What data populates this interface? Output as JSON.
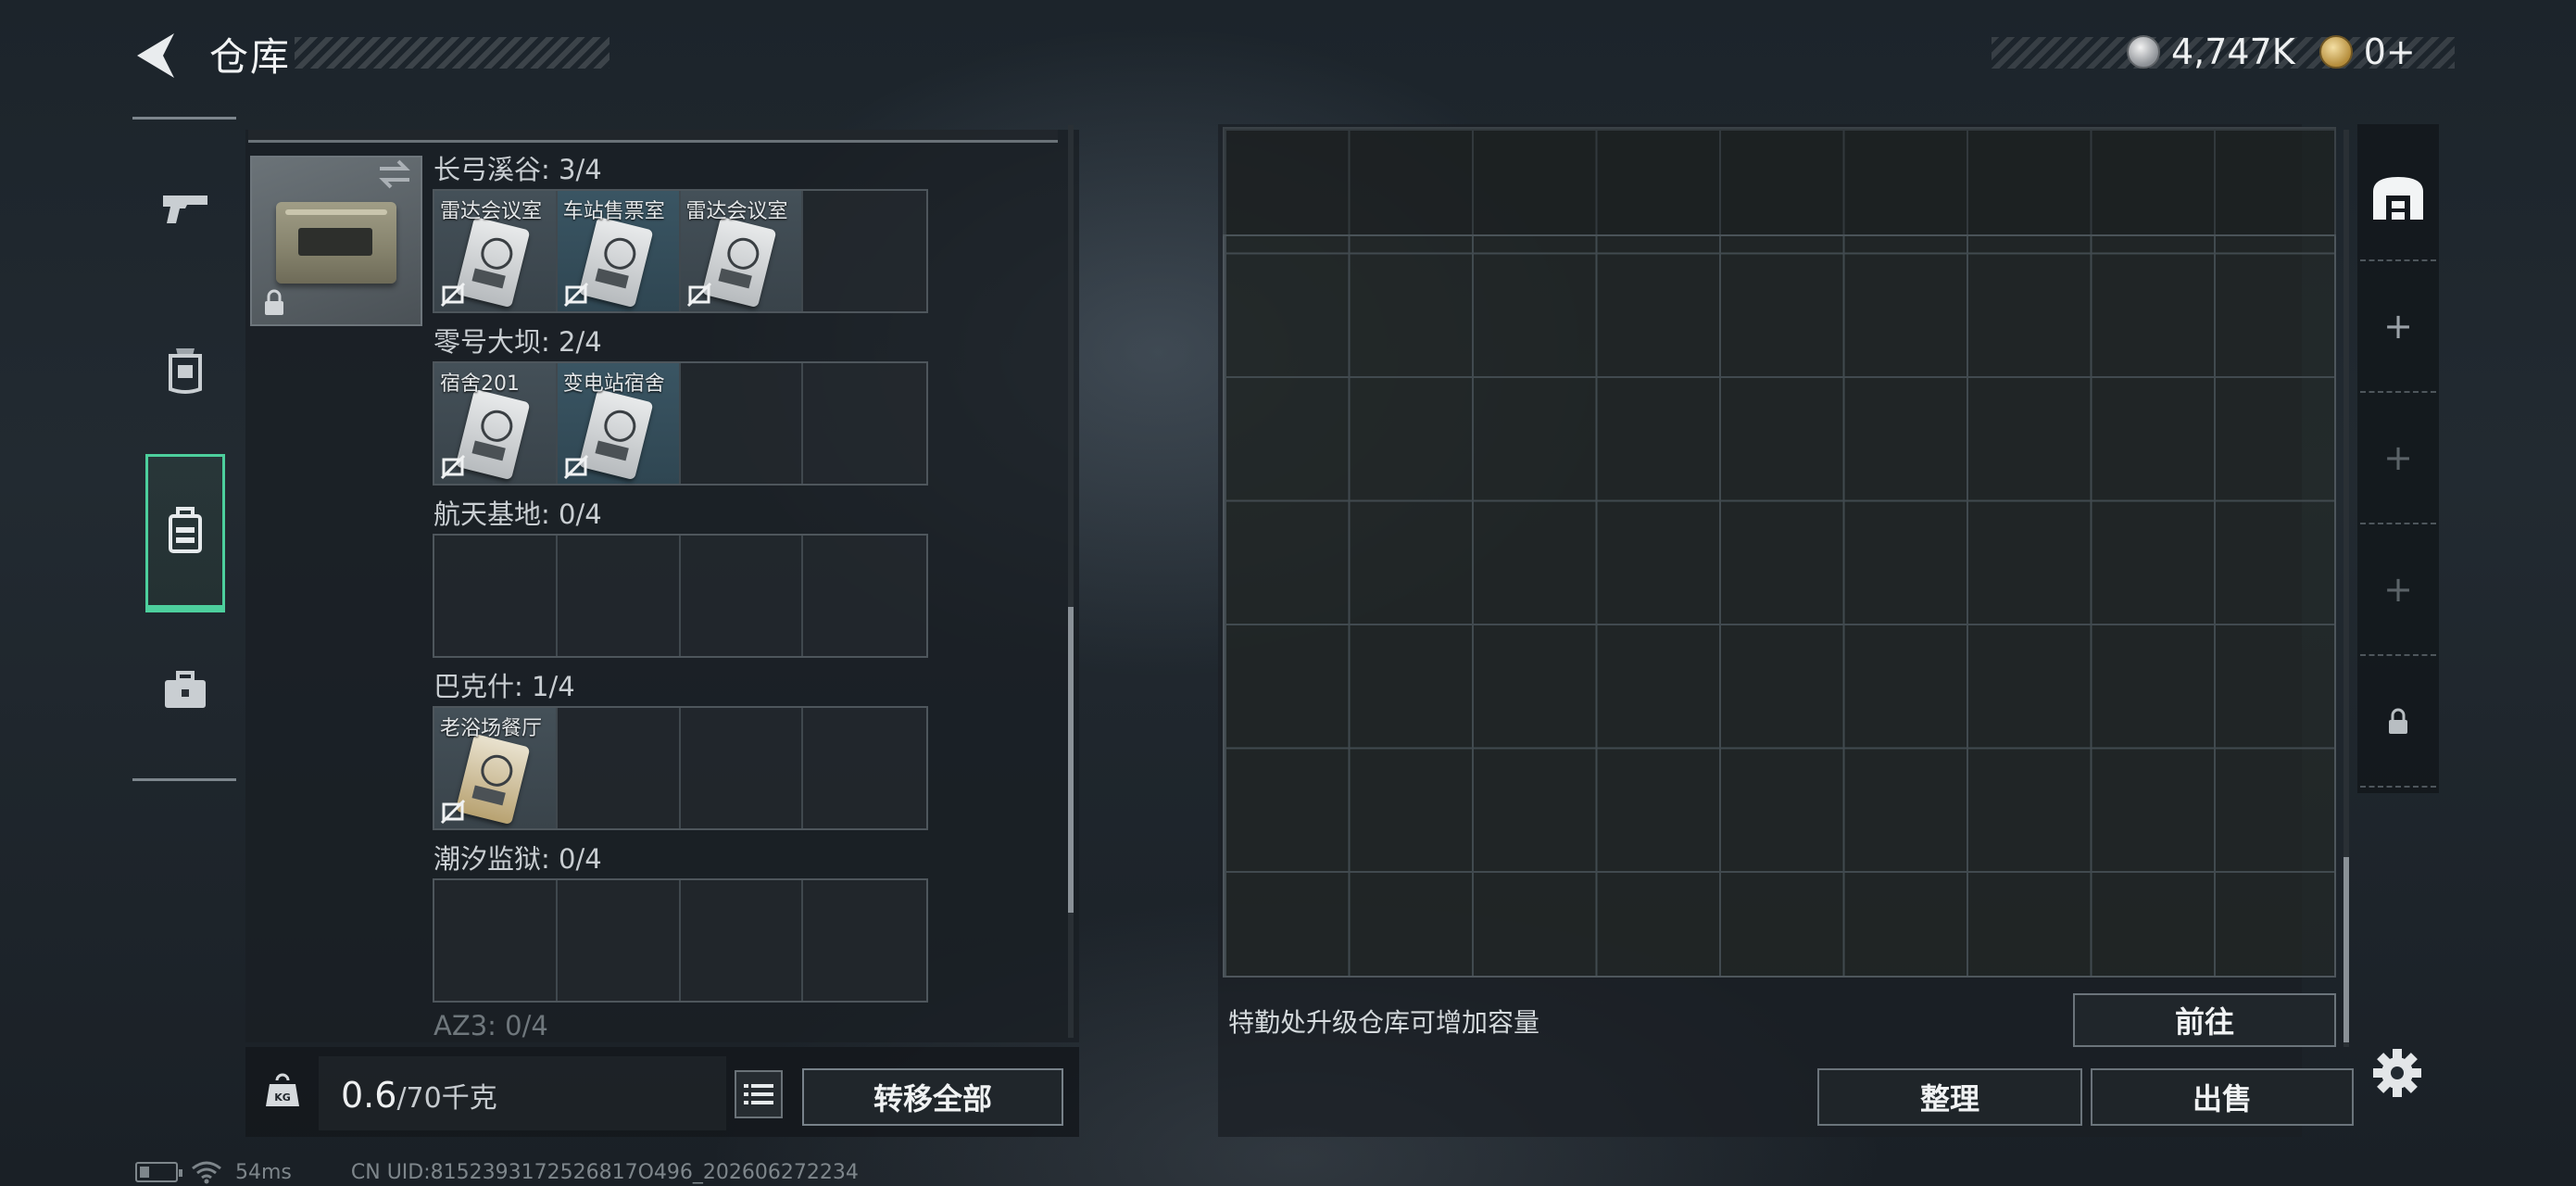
{
  "header": {
    "title": "仓库",
    "currency_primary": "4,747K",
    "currency_secondary": "0+"
  },
  "tabs": [
    {
      "name": "weapon",
      "icon": "pistol-icon"
    },
    {
      "name": "armor",
      "icon": "vest-icon"
    },
    {
      "name": "storage",
      "icon": "backpack-icon",
      "active": true
    },
    {
      "name": "case",
      "icon": "briefcase-icon"
    }
  ],
  "key_sections": [
    {
      "title": "长弓溪谷: 3/4",
      "slots": [
        "雷达会议室",
        "车站售票室",
        "雷达会议室",
        ""
      ]
    },
    {
      "title": "零号大坝: 2/4",
      "slots": [
        "宿舍201",
        "变电站宿舍",
        "",
        ""
      ]
    },
    {
      "title": "航天基地: 0/4",
      "slots": [
        "",
        "",
        "",
        ""
      ]
    },
    {
      "title": "巴克什: 1/4",
      "slots": [
        "老浴场餐厅",
        "",
        "",
        ""
      ]
    },
    {
      "title": "潮汐监狱: 0/4",
      "slots": [
        "",
        "",
        "",
        ""
      ]
    },
    {
      "title": "AZ3: 0/4"
    }
  ],
  "weight": {
    "current": "0.6",
    "max": "/70千克"
  },
  "buttons": {
    "transfer_all": "转移全部",
    "goto": "前往",
    "sort": "整理",
    "sell": "出售"
  },
  "tip": "特勤处升级仓库可增加容量",
  "status": {
    "ping": "54ms",
    "uid": "CN UID:8152393172526817O496_202606272234"
  },
  "colors": {
    "accent": "#4dcf9d",
    "panel": "#1a1f24"
  }
}
